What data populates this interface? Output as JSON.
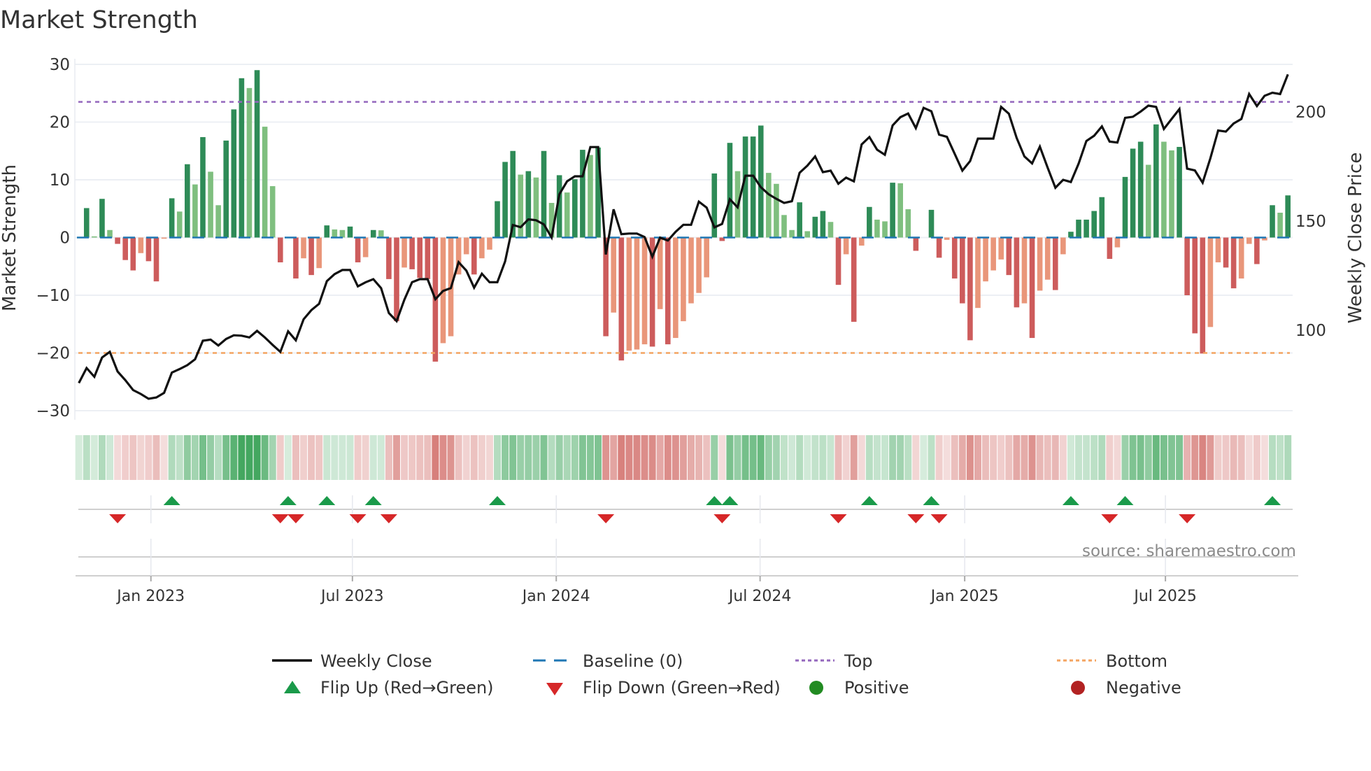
{
  "title": "Market Strength",
  "source": "source: sharemaestro.com",
  "colors": {
    "strong_up": "#2e8b57",
    "weak_up": "#7fbf7f",
    "strong_down": "#cd5c5c",
    "weak_down": "#e9967a",
    "close": "#111111",
    "baseline": "#1f77b4",
    "top": "#9467bd",
    "bottom": "#f4a460",
    "flip_up": "#1a9a4a",
    "flip_down": "#d62728",
    "positive": "#228b22",
    "negative": "#b22222"
  },
  "legend": {
    "weekly_close": "Weekly Close",
    "baseline": "Baseline (0)",
    "top": "Top",
    "bottom": "Bottom",
    "flip_up": "Flip Up (Red→Green)",
    "flip_down": "Flip Down (Green→Red)",
    "positive": "Positive",
    "negative": "Negative"
  },
  "chart_data": {
    "type": "bar",
    "title": "Market Strength",
    "ylabel": "Market Strength",
    "y2label": "Weekly Close Price",
    "ylim": [
      -30,
      30
    ],
    "y2ticks": [
      "200",
      "150",
      "100"
    ],
    "y2tick_values": [
      200,
      150,
      100
    ],
    "yticks": [
      "30",
      "20",
      "10",
      "0",
      "−10",
      "−20",
      "−30"
    ],
    "ytick_values": [
      30,
      20,
      10,
      0,
      -10,
      -20,
      -30
    ],
    "xticks": [
      "Jan 2023",
      "Jul 2023",
      "Jan 2024",
      "Jul 2024",
      "Jan 2025",
      "Jul 2025"
    ],
    "xtick_week_index": [
      9.3,
      35.3,
      61.6,
      87.9,
      114.3,
      140.2
    ],
    "top_level": 23.5,
    "bottom_level": -20,
    "baseline": 0,
    "grid": true,
    "legend_placement": "bottom",
    "strength": [
      0,
      5.1,
      0.2,
      6.7,
      1.3,
      -1.1,
      -3.9,
      -5.7,
      -2.7,
      -4.1,
      -7.6,
      -0.2,
      6.8,
      4.5,
      12.7,
      9.2,
      17.4,
      11.4,
      5.6,
      16.8,
      22.2,
      27.6,
      25.9,
      29,
      19.2,
      8.9,
      -4.3,
      0,
      -7.1,
      -3.6,
      -6.5,
      -5.3,
      2.1,
      1.4,
      1.3,
      1.9,
      -4.3,
      -3.4,
      1.3,
      1.25,
      -7.2,
      -14.5,
      -5.2,
      -5.5,
      -7,
      -7.2,
      -21.5,
      -18.3,
      -17.1,
      -6.4,
      -2.9,
      -6.4,
      -3.6,
      -2.1,
      6.3,
      13.1,
      15,
      10.9,
      11.5,
      10.4,
      15,
      6,
      10.8,
      7.8,
      10.1,
      15.2,
      14.3,
      15.6,
      -17.1,
      -13,
      -21.3,
      -19.6,
      -19.4,
      -18.5,
      -18.9,
      -12.4,
      -18.5,
      -17.4,
      -14.5,
      -11.4,
      -9.6,
      -6.9,
      11.1,
      -0.6,
      16.4,
      11.5,
      17.5,
      17.5,
      19.4,
      11.2,
      9.3,
      3.9,
      1.3,
      6.1,
      1.1,
      3.6,
      4.6,
      2.7,
      -8.2,
      -2.9,
      -14.6,
      -1.4,
      5.3,
      3.1,
      2.8,
      9.5,
      9.4,
      4.9,
      -2.3,
      0,
      4.8,
      -3.5,
      -0.4,
      -7.1,
      -11.4,
      -17.8,
      -12.2,
      -7.6,
      -5.7,
      -3.8,
      -6.5,
      -12.1,
      -11.4,
      -17.4,
      -9.2,
      -7.3,
      -9.1,
      -2.9,
      1,
      3.1,
      3.1,
      4.6,
      7,
      -3.7,
      -1.7,
      10.5,
      15.4,
      16.6,
      12.6,
      19.6,
      16.6,
      15.1,
      15.7,
      -10,
      -16.6,
      -20.1,
      -15.5,
      -4.3,
      -5.2,
      -8.8,
      -7.1,
      -1.1,
      -4.6,
      -0.5,
      5.6,
      4.3,
      7.3
    ],
    "weekly_close": [
      75.8,
      82.7,
      78.7,
      87.5,
      90.1,
      81.1,
      77.1,
      72.6,
      70.8,
      68.6,
      69.2,
      71.3,
      80.6,
      82.2,
      84,
      86.7,
      95.2,
      95.7,
      93,
      96,
      97.7,
      97.5,
      96.7,
      99.7,
      96.7,
      93.3,
      90.1,
      99.5,
      95.4,
      105,
      109.2,
      112.1,
      122.5,
      125.7,
      127.6,
      127.6,
      120.1,
      122,
      123.4,
      119.3,
      107.9,
      104.2,
      114,
      122,
      123.4,
      123.4,
      114.2,
      118,
      119.3,
      131.2,
      127.3,
      119.5,
      125.9,
      122,
      122,
      131.5,
      148.2,
      147.2,
      150.8,
      150.4,
      148.5,
      142.5,
      162.3,
      168.2,
      170.5,
      170.5,
      183.9,
      183.9,
      134.7,
      155.4,
      144,
      144.3,
      144.3,
      142.7,
      133.7,
      142.4,
      141.1,
      145.1,
      148.3,
      148.3,
      158.9,
      156.2,
      147.1,
      148.7,
      160,
      156.3,
      170.8,
      170.8,
      165.5,
      162.3,
      160.2,
      158.3,
      159.1,
      172.1,
      175.4,
      179.6,
      172.4,
      173.1,
      167.1,
      169.9,
      168.2,
      185.1,
      188.5,
      182.7,
      180.4,
      193.8,
      197.6,
      199.3,
      192.6,
      201.9,
      200.3,
      189.6,
      188.6,
      180.9,
      173.1,
      177.5,
      187.8,
      187.8,
      187.8,
      202.3,
      199.2,
      188.1,
      179.6,
      176.4,
      184.1,
      174.5,
      165.3,
      168.9,
      167.9,
      176.3,
      186.7,
      189.1,
      193.4,
      186.4,
      186,
      197.3,
      197.8,
      200.2,
      202.9,
      202.3,
      192.2,
      196.8,
      201.3,
      174,
      173.2,
      167.6,
      178.8,
      191.5,
      191,
      194.7,
      196.8,
      208.2,
      202.7,
      207.4,
      208.8,
      208.2,
      217.2
    ],
    "flip_up_weeks": [
      12,
      27,
      32,
      38,
      54,
      82,
      84,
      102,
      110,
      128,
      135,
      154
    ],
    "flip_down_weeks": [
      5,
      26,
      28,
      36,
      40,
      68,
      83,
      98,
      108,
      111,
      133,
      143
    ]
  }
}
